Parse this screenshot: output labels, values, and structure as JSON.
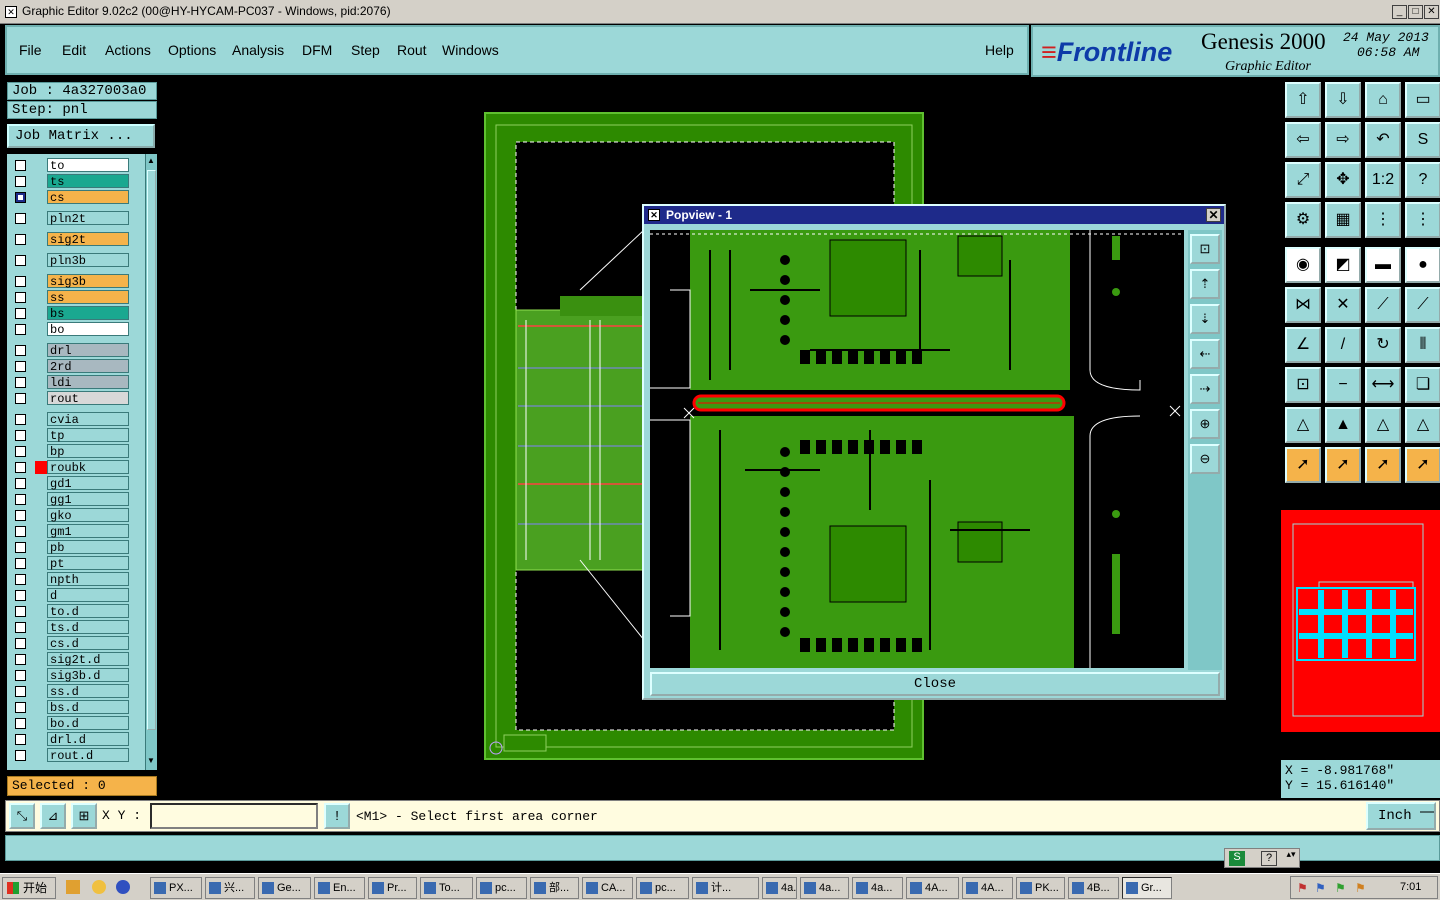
{
  "window": {
    "title": "Graphic Editor 9.02c2 (00@HY-HYCAM-PC037 - Windows, pid:2076)"
  },
  "menu": {
    "file": "File",
    "edit": "Edit",
    "actions": "Actions",
    "options": "Options",
    "analysis": "Analysis",
    "dfm": "DFM",
    "step": "Step",
    "rout": "Rout",
    "windows": "Windows",
    "help": "Help"
  },
  "brand": {
    "logo": "Frontline",
    "product": "Genesis 2000",
    "subtitle": "Graphic Editor",
    "date": "24 May 2013",
    "time": "06:58 AM"
  },
  "job": {
    "job_line": "Job : 4a327003a0",
    "step_line": "Step: pnl",
    "matrix_button": "Job Matrix ..."
  },
  "layers": [
    {
      "name": "to",
      "color": "#ffffff",
      "checked": false
    },
    {
      "name": "ts",
      "color": "#1aa890",
      "checked": false
    },
    {
      "name": "cs",
      "color": "#f5b34a",
      "checked": true
    },
    {
      "name": "pln2t",
      "color": "#9cd8d8",
      "checked": false
    },
    {
      "name": "sig2t",
      "color": "#f5b34a",
      "checked": false
    },
    {
      "name": "pln3b",
      "color": "#9cd8d8",
      "checked": false
    },
    {
      "name": "sig3b",
      "color": "#f5b34a",
      "checked": false
    },
    {
      "name": "ss",
      "color": "#f5b34a",
      "checked": false
    },
    {
      "name": "bs",
      "color": "#1aa890",
      "checked": false
    },
    {
      "name": "bo",
      "color": "#ffffff",
      "checked": false
    },
    {
      "name": "drl",
      "color": "#a8b8c0",
      "checked": false
    },
    {
      "name": "2rd",
      "color": "#a8b8c0",
      "checked": false
    },
    {
      "name": "ldi",
      "color": "#a8b8c0",
      "checked": false
    },
    {
      "name": "rout",
      "color": "#d8d8d8",
      "checked": false
    },
    {
      "name": "cvia",
      "color": "#9cd8d8",
      "checked": false
    },
    {
      "name": "tp",
      "color": "#9cd8d8",
      "checked": false
    },
    {
      "name": "bp",
      "color": "#9cd8d8",
      "checked": false
    },
    {
      "name": "roubk",
      "color": "#9cd8d8",
      "checked": false
    },
    {
      "name": "gd1",
      "color": "#9cd8d8",
      "checked": false
    },
    {
      "name": "gg1",
      "color": "#9cd8d8",
      "checked": false
    },
    {
      "name": "gko",
      "color": "#9cd8d8",
      "checked": false
    },
    {
      "name": "gm1",
      "color": "#9cd8d8",
      "checked": false
    },
    {
      "name": "pb",
      "color": "#9cd8d8",
      "checked": false
    },
    {
      "name": "pt",
      "color": "#9cd8d8",
      "checked": false
    },
    {
      "name": "npth",
      "color": "#9cd8d8",
      "checked": false
    },
    {
      "name": "d",
      "color": "#9cd8d8",
      "checked": false
    },
    {
      "name": "to.d",
      "color": "#9cd8d8",
      "checked": false
    },
    {
      "name": "ts.d",
      "color": "#9cd8d8",
      "checked": false
    },
    {
      "name": "cs.d",
      "color": "#9cd8d8",
      "checked": false
    },
    {
      "name": "sig2t.d",
      "color": "#9cd8d8",
      "checked": false
    },
    {
      "name": "sig3b.d",
      "color": "#9cd8d8",
      "checked": false
    },
    {
      "name": "ss.d",
      "color": "#9cd8d8",
      "checked": false
    },
    {
      "name": "bs.d",
      "color": "#9cd8d8",
      "checked": false
    },
    {
      "name": "bo.d",
      "color": "#9cd8d8",
      "checked": false
    },
    {
      "name": "drl.d",
      "color": "#9cd8d8",
      "checked": false
    },
    {
      "name": "rout.d",
      "color": "#9cd8d8",
      "checked": false
    }
  ],
  "selected": "Selected : 0",
  "popview": {
    "title": "Popview - 1",
    "close_label": "Close"
  },
  "coords": {
    "x": "X = -8.981768\"",
    "y": "Y = 15.616140\""
  },
  "command": {
    "xy_label": "X Y :",
    "message": "<M1> - Select first area corner",
    "unit": "Inch"
  },
  "taskbar": {
    "start": "开始",
    "clock": "7:01",
    "tasks": [
      "PX...",
      "兴...",
      "Ge...",
      "En...",
      "Pr...",
      "To...",
      "pc...",
      "部...",
      "CA...",
      "pc...",
      "计...",
      "4a...",
      "4a...",
      "4a...",
      "4A...",
      "4A...",
      "PK...",
      "4B...",
      "Gr..."
    ]
  },
  "colors": {
    "panel": "#9cd8d8",
    "board": "#2d8a00",
    "highlight": "#ff0000",
    "accent": "#f5b34a"
  }
}
